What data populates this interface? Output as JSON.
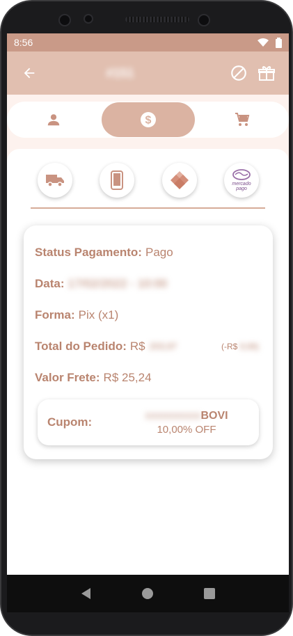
{
  "statusbar": {
    "time": "8:56"
  },
  "appbar": {
    "title": "#151",
    "back_icon": "arrow-left-icon",
    "cancel_icon": "block-icon",
    "package_icon": "package-icon"
  },
  "tabs": [
    {
      "name": "customer",
      "icon": "person-icon",
      "active": false
    },
    {
      "name": "payment",
      "icon": "dollar-icon",
      "active": true
    },
    {
      "name": "cart",
      "icon": "cart-icon",
      "active": false
    }
  ],
  "methods": [
    {
      "name": "delivery",
      "icon": "truck-icon"
    },
    {
      "name": "mobile",
      "icon": "phone-icon"
    },
    {
      "name": "pix",
      "icon": "pix-icon"
    },
    {
      "name": "mercadopago",
      "icon": "mercado-pago-icon",
      "text": "mercado pago"
    }
  ],
  "details": {
    "status_label": "Status Pagamento:",
    "status_value": "Pago",
    "date_label": "Data:",
    "date_value": "17/02/2022 - 10:00",
    "form_label": "Forma:",
    "form_value": "Pix (x1)",
    "total_label": "Total do Pedido:",
    "total_currency": "R$",
    "total_value": "203,97",
    "total_discount_prefix": "(-R$",
    "total_discount_value": "9,99)",
    "freight_label": "Valor Frete:",
    "freight_value": "R$ 25,24"
  },
  "coupon": {
    "label": "Cupom:",
    "code_hidden": "XXXXXXXXXX",
    "code_suffix": "BOVI",
    "off": "10,00% OFF"
  },
  "colors": {
    "accent": "#b9846f",
    "appbar": "#e1bfb0",
    "active_tab": "#dbb3a2"
  }
}
